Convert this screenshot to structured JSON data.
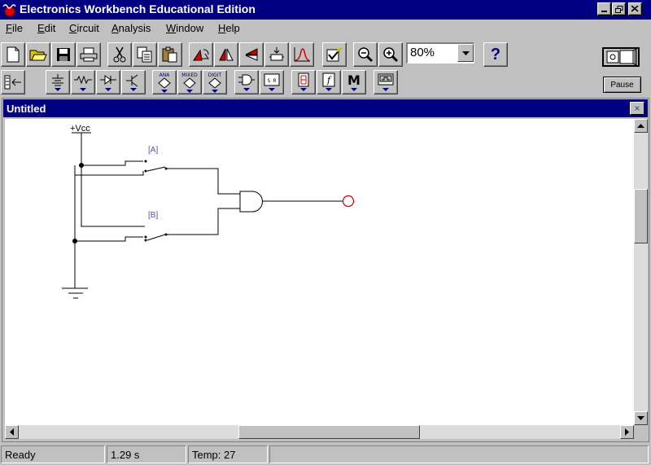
{
  "window": {
    "title": "Electronics Workbench Educational Edition"
  },
  "menu": [
    {
      "label": "File",
      "key": "F",
      "rest": "ile"
    },
    {
      "label": "Edit",
      "key": "E",
      "rest": "dit"
    },
    {
      "label": "Circuit",
      "key": "C",
      "rest": "ircuit"
    },
    {
      "label": "Analysis",
      "key": "A",
      "rest": "nalysis"
    },
    {
      "label": "Window",
      "key": "W",
      "rest": "indow"
    },
    {
      "label": "Help",
      "key": "H",
      "rest": "elp"
    }
  ],
  "toolbar": {
    "zoom_value": "80%",
    "help_label": "?",
    "pause_label": "Pause",
    "parts_labels": {
      "analog": "ANA",
      "mixed": "MIXED",
      "digital": "DIGIT",
      "sr": "S R",
      "misc": "M"
    }
  },
  "document": {
    "title": "Untitled",
    "close_label": "×"
  },
  "circuit": {
    "vcc_label": "+Vcc",
    "switch_a_label": "[A]",
    "switch_b_label": "[B]",
    "colors": {
      "wire": "#000000",
      "label": "#5050b0",
      "probe": "#d00000"
    }
  },
  "status": {
    "state": "Ready",
    "time": "1.29 s",
    "temp": "Temp: 27",
    "extra": ""
  }
}
